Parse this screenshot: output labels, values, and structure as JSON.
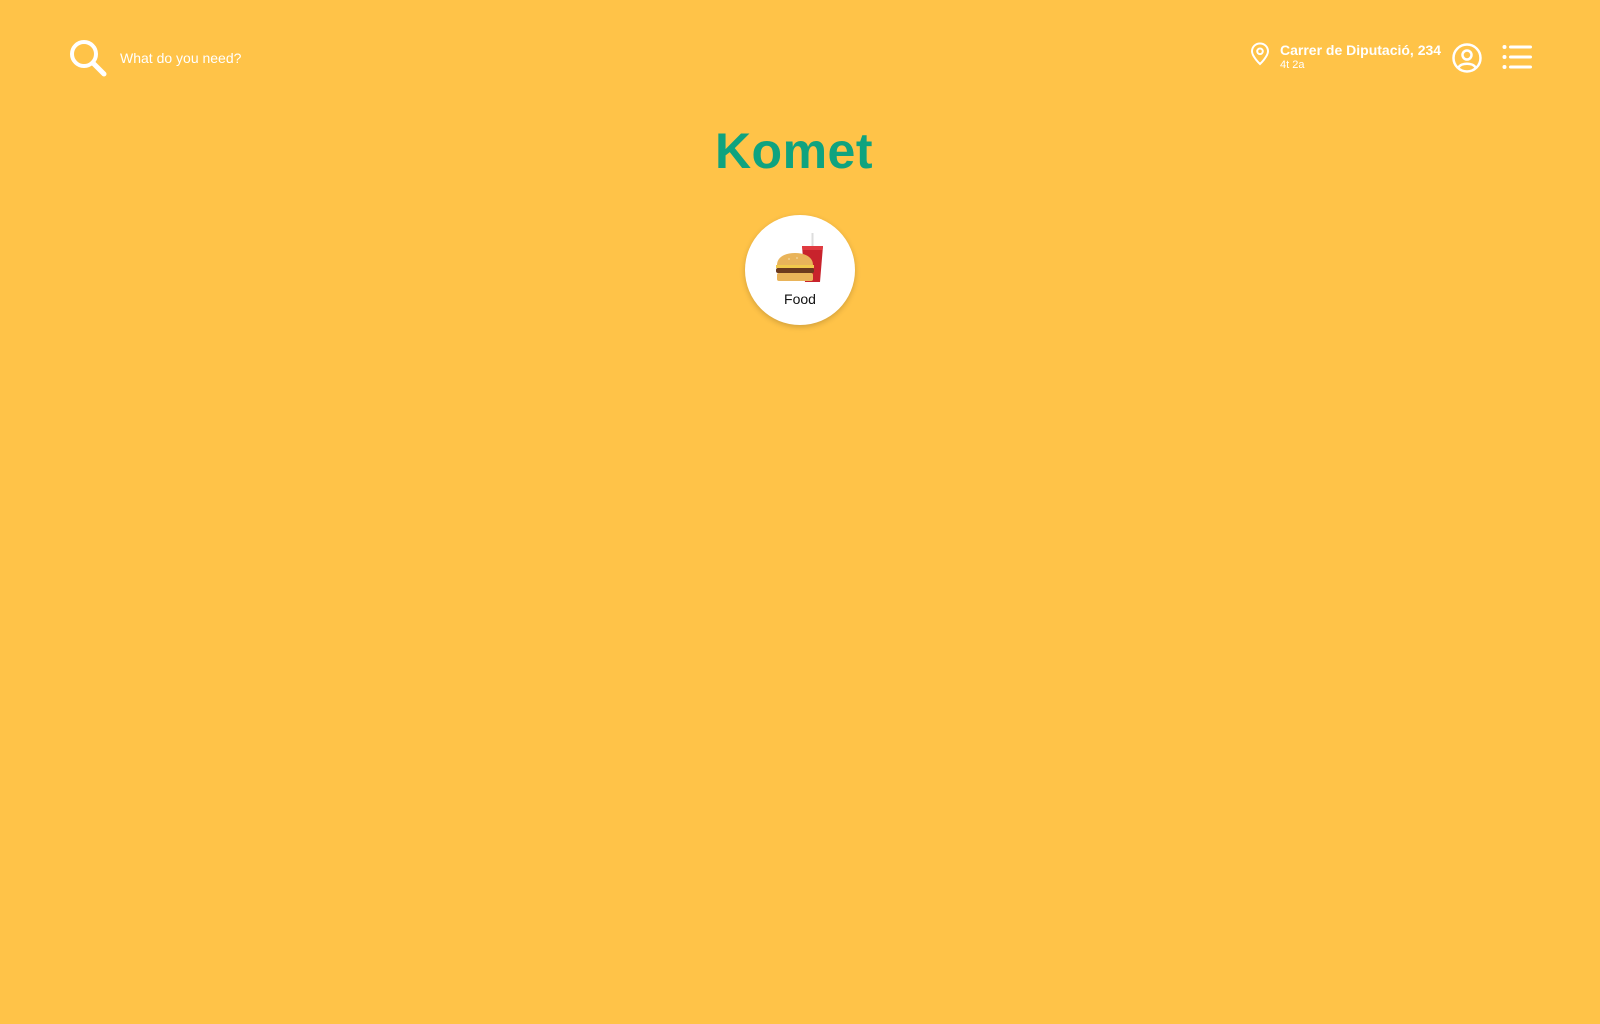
{
  "search": {
    "placeholder": "What do you need?"
  },
  "address": {
    "line1": "Carrer de Diputació, 234",
    "line2": "4t 2a"
  },
  "brand": {
    "title": "Komet",
    "color": "#0FA37F"
  },
  "categories": [
    {
      "label": "Food",
      "icon": "burger-and-drink-icon"
    }
  ],
  "colors": {
    "background": "#FFC348",
    "header_text": "#FFFFFF"
  },
  "icons": {
    "search": "search-icon",
    "location": "location-pin-icon",
    "account": "account-icon",
    "menu": "menu-list-icon"
  }
}
